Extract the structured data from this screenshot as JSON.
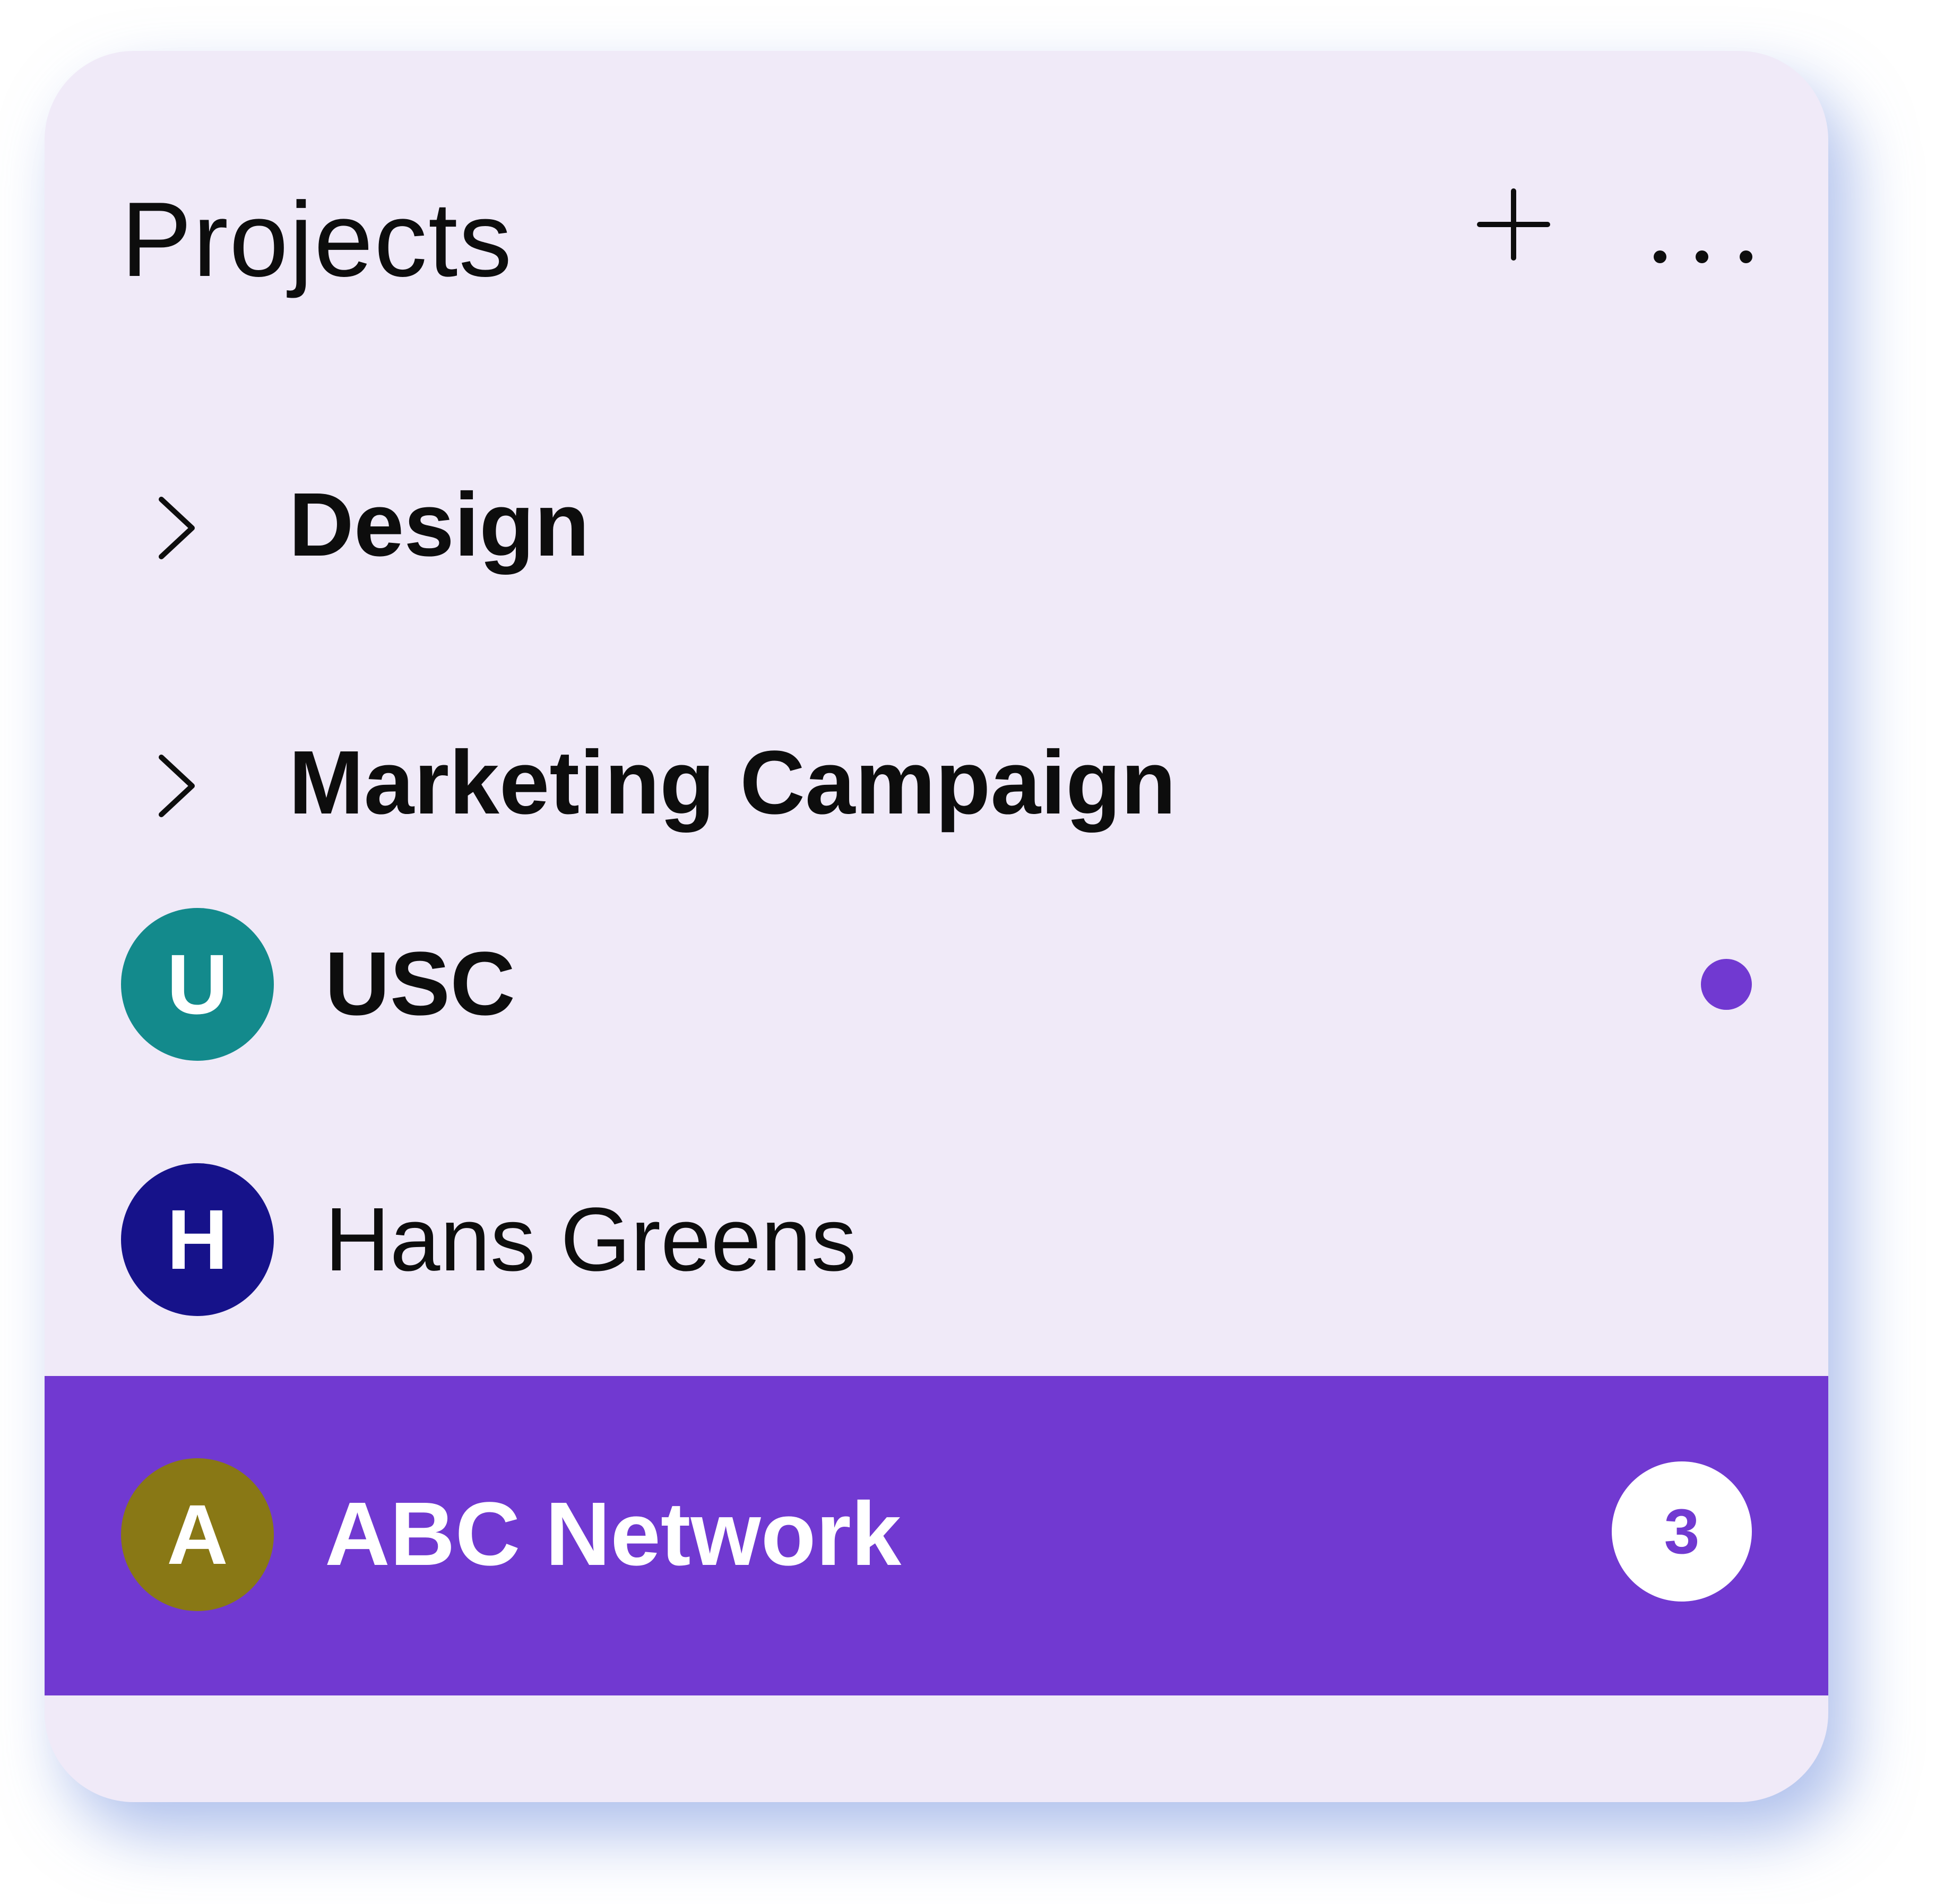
{
  "header": {
    "title": "Projects",
    "add_icon": "plus-icon",
    "more_icon": "more-horizontal-icon"
  },
  "folders": [
    {
      "label": "Design",
      "icon": "chevron-right-icon",
      "expanded": false
    },
    {
      "label": "Marketing Campaign",
      "icon": "chevron-right-icon",
      "expanded": false
    }
  ],
  "clients": [
    {
      "initial": "U",
      "label": "USC",
      "avatar_color": "#138a8c",
      "bold": true,
      "unread_dot": true,
      "unread_dot_color": "#7139d1",
      "selected": false
    },
    {
      "initial": "H",
      "label": "Hans Greens",
      "avatar_color": "#16128a",
      "bold": false,
      "unread_dot": false,
      "selected": false
    },
    {
      "initial": "A",
      "label": "ABC Network",
      "avatar_color": "#897815",
      "bold": true,
      "badge_count": "3",
      "selected": true
    }
  ],
  "colors": {
    "card_background": "#f0eaf8",
    "selected_background": "#7139d1",
    "text_primary": "#0d0d0d",
    "text_on_selected": "#ffffff"
  }
}
